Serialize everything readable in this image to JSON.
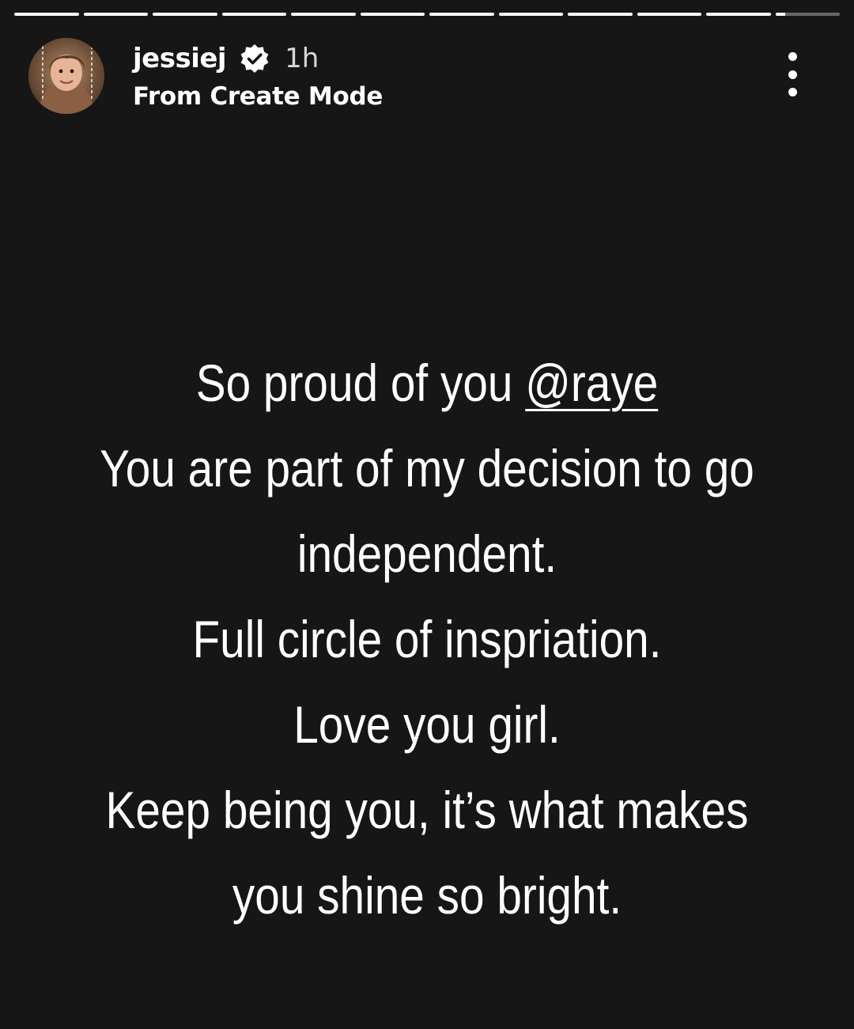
{
  "story": {
    "progress_segments": [
      1,
      1,
      1,
      1,
      1,
      1,
      1,
      1,
      1,
      1,
      1,
      0.15
    ],
    "username": "jessiej",
    "verified_icon": "verified-badge-icon",
    "time_ago": "1h",
    "subtitle": "From Create Mode",
    "more_icon": "more-vertical-icon",
    "text": {
      "line1_prefix": "So proud of you ",
      "mention": "@raye",
      "line2": "You are part of my decision to go",
      "line3": "independent.",
      "line4": "Full circle of inspriation.",
      "line5": "Love you girl.",
      "line6": "Keep being you, it’s what makes",
      "line7": "you shine so bright."
    }
  },
  "colors": {
    "background": "#161616",
    "text": "#ffffff",
    "progress_track": "#5c5c5c",
    "progress_fill": "#ffffff"
  }
}
